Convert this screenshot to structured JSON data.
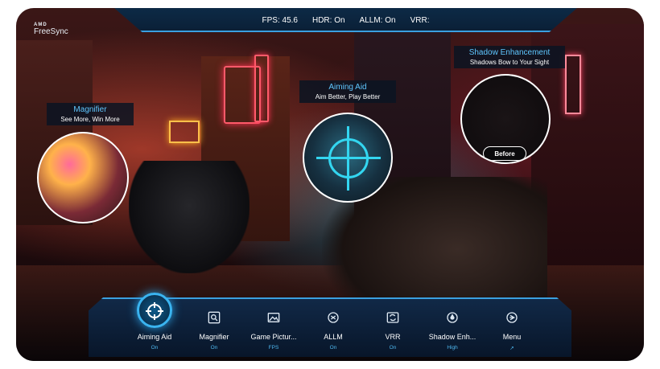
{
  "logo": {
    "brand": "AMD",
    "product": "FreeSync"
  },
  "status_bar": {
    "fps": "FPS: 45.6",
    "hdr": "HDR: On",
    "allm": "ALLM: On",
    "vrr": "VRR:"
  },
  "callouts": {
    "magnifier": {
      "title": "Magnifier",
      "subtitle": "See More, Win More"
    },
    "aiming_aid": {
      "title": "Aiming Aid",
      "subtitle": "Aim Better, Play Better"
    },
    "shadow": {
      "title": "Shadow Enhancement",
      "subtitle": "Shadows Bow to Your Sight",
      "badge": "Before"
    }
  },
  "menu": {
    "items": [
      {
        "label": "Aiming Aid",
        "value": "On",
        "icon": "crosshair-icon",
        "active": true
      },
      {
        "label": "Magnifier",
        "value": "On",
        "icon": "magnifier-icon"
      },
      {
        "label": "Game Pictur...",
        "value": "FPS",
        "icon": "picture-icon"
      },
      {
        "label": "ALLM",
        "value": "On",
        "icon": "allm-icon"
      },
      {
        "label": "VRR",
        "value": "On",
        "icon": "vrr-icon"
      },
      {
        "label": "Shadow Enh...",
        "value": "High",
        "icon": "shadow-icon"
      },
      {
        "label": "Menu",
        "value": "↗",
        "icon": "menu-icon"
      }
    ]
  },
  "colors": {
    "accent": "#3aa0e0",
    "value_text": "#4fb8f0",
    "callout_title": "#5fc7ff"
  }
}
